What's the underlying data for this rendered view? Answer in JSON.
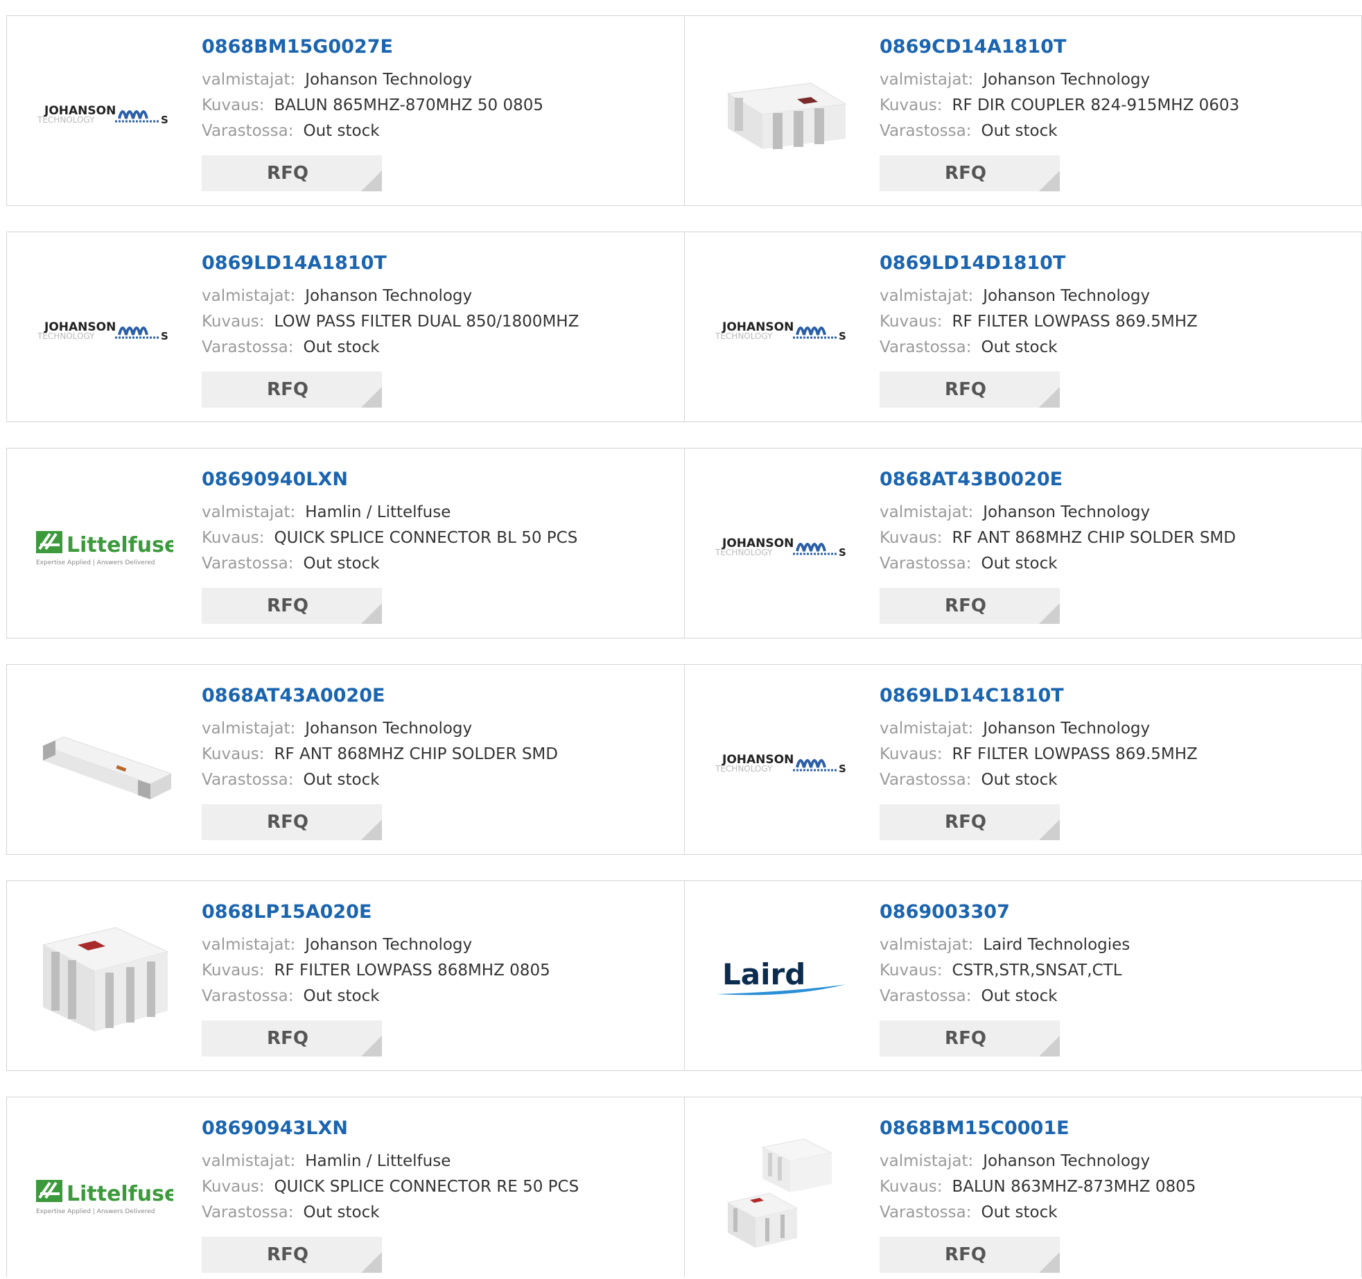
{
  "labels": {
    "manufacturer": "valmistajat:",
    "description": "Kuvaus:",
    "stock": "Varastossa:",
    "rfq": "RFQ"
  },
  "colors": {
    "part_link": "#1a64b0",
    "border": "#d4d4d4",
    "rfq_bg": "#efefef",
    "label": "#9a9a9a"
  },
  "products": [
    {
      "part": "0868BM15G0027E",
      "manufacturer": "Johanson Technology",
      "description": "BALUN 865MHZ-870MHZ 50 0805",
      "stock": "Out stock",
      "image": "johanson-logo"
    },
    {
      "part": "0869CD14A1810T",
      "manufacturer": "Johanson Technology",
      "description": "RF DIR COUPLER 824-915MHZ 0603",
      "stock": "Out stock",
      "image": "chip-component-photo"
    },
    {
      "part": "0869LD14A1810T",
      "manufacturer": "Johanson Technology",
      "description": "LOW PASS FILTER DUAL 850/1800MHZ",
      "stock": "Out stock",
      "image": "johanson-logo"
    },
    {
      "part": "0869LD14D1810T",
      "manufacturer": "Johanson Technology",
      "description": "RF FILTER LOWPASS 869.5MHZ",
      "stock": "Out stock",
      "image": "johanson-logo"
    },
    {
      "part": "08690940LXN",
      "manufacturer": "Hamlin / Littelfuse",
      "description": "QUICK SPLICE CONNECTOR BL 50 PCS",
      "stock": "Out stock",
      "image": "littelfuse-logo"
    },
    {
      "part": "0868AT43B0020E",
      "manufacturer": "Johanson Technology",
      "description": "RF ANT 868MHZ CHIP SOLDER SMD",
      "stock": "Out stock",
      "image": "johanson-logo"
    },
    {
      "part": "0868AT43A0020E",
      "manufacturer": "Johanson Technology",
      "description": "RF ANT 868MHZ CHIP SOLDER SMD",
      "stock": "Out stock",
      "image": "antenna-chip-photo"
    },
    {
      "part": "0869LD14C1810T",
      "manufacturer": "Johanson Technology",
      "description": "RF FILTER LOWPASS 869.5MHZ",
      "stock": "Out stock",
      "image": "johanson-logo"
    },
    {
      "part": "0868LP15A020E",
      "manufacturer": "Johanson Technology",
      "description": "RF FILTER LOWPASS 868MHZ 0805",
      "stock": "Out stock",
      "image": "filter-chip-photo"
    },
    {
      "part": "0869003307",
      "manufacturer": "Laird Technologies",
      "description": "CSTR,STR,SNSAT,CTL",
      "stock": "Out stock",
      "image": "laird-logo"
    },
    {
      "part": "08690943LXN",
      "manufacturer": "Hamlin / Littelfuse",
      "description": "QUICK SPLICE CONNECTOR RE 50 PCS",
      "stock": "Out stock",
      "image": "littelfuse-logo"
    },
    {
      "part": "0868BM15C0001E",
      "manufacturer": "Johanson Technology",
      "description": "BALUN 863MHZ-873MHZ 0805",
      "stock": "Out stock",
      "image": "balun-chips-photo"
    }
  ]
}
